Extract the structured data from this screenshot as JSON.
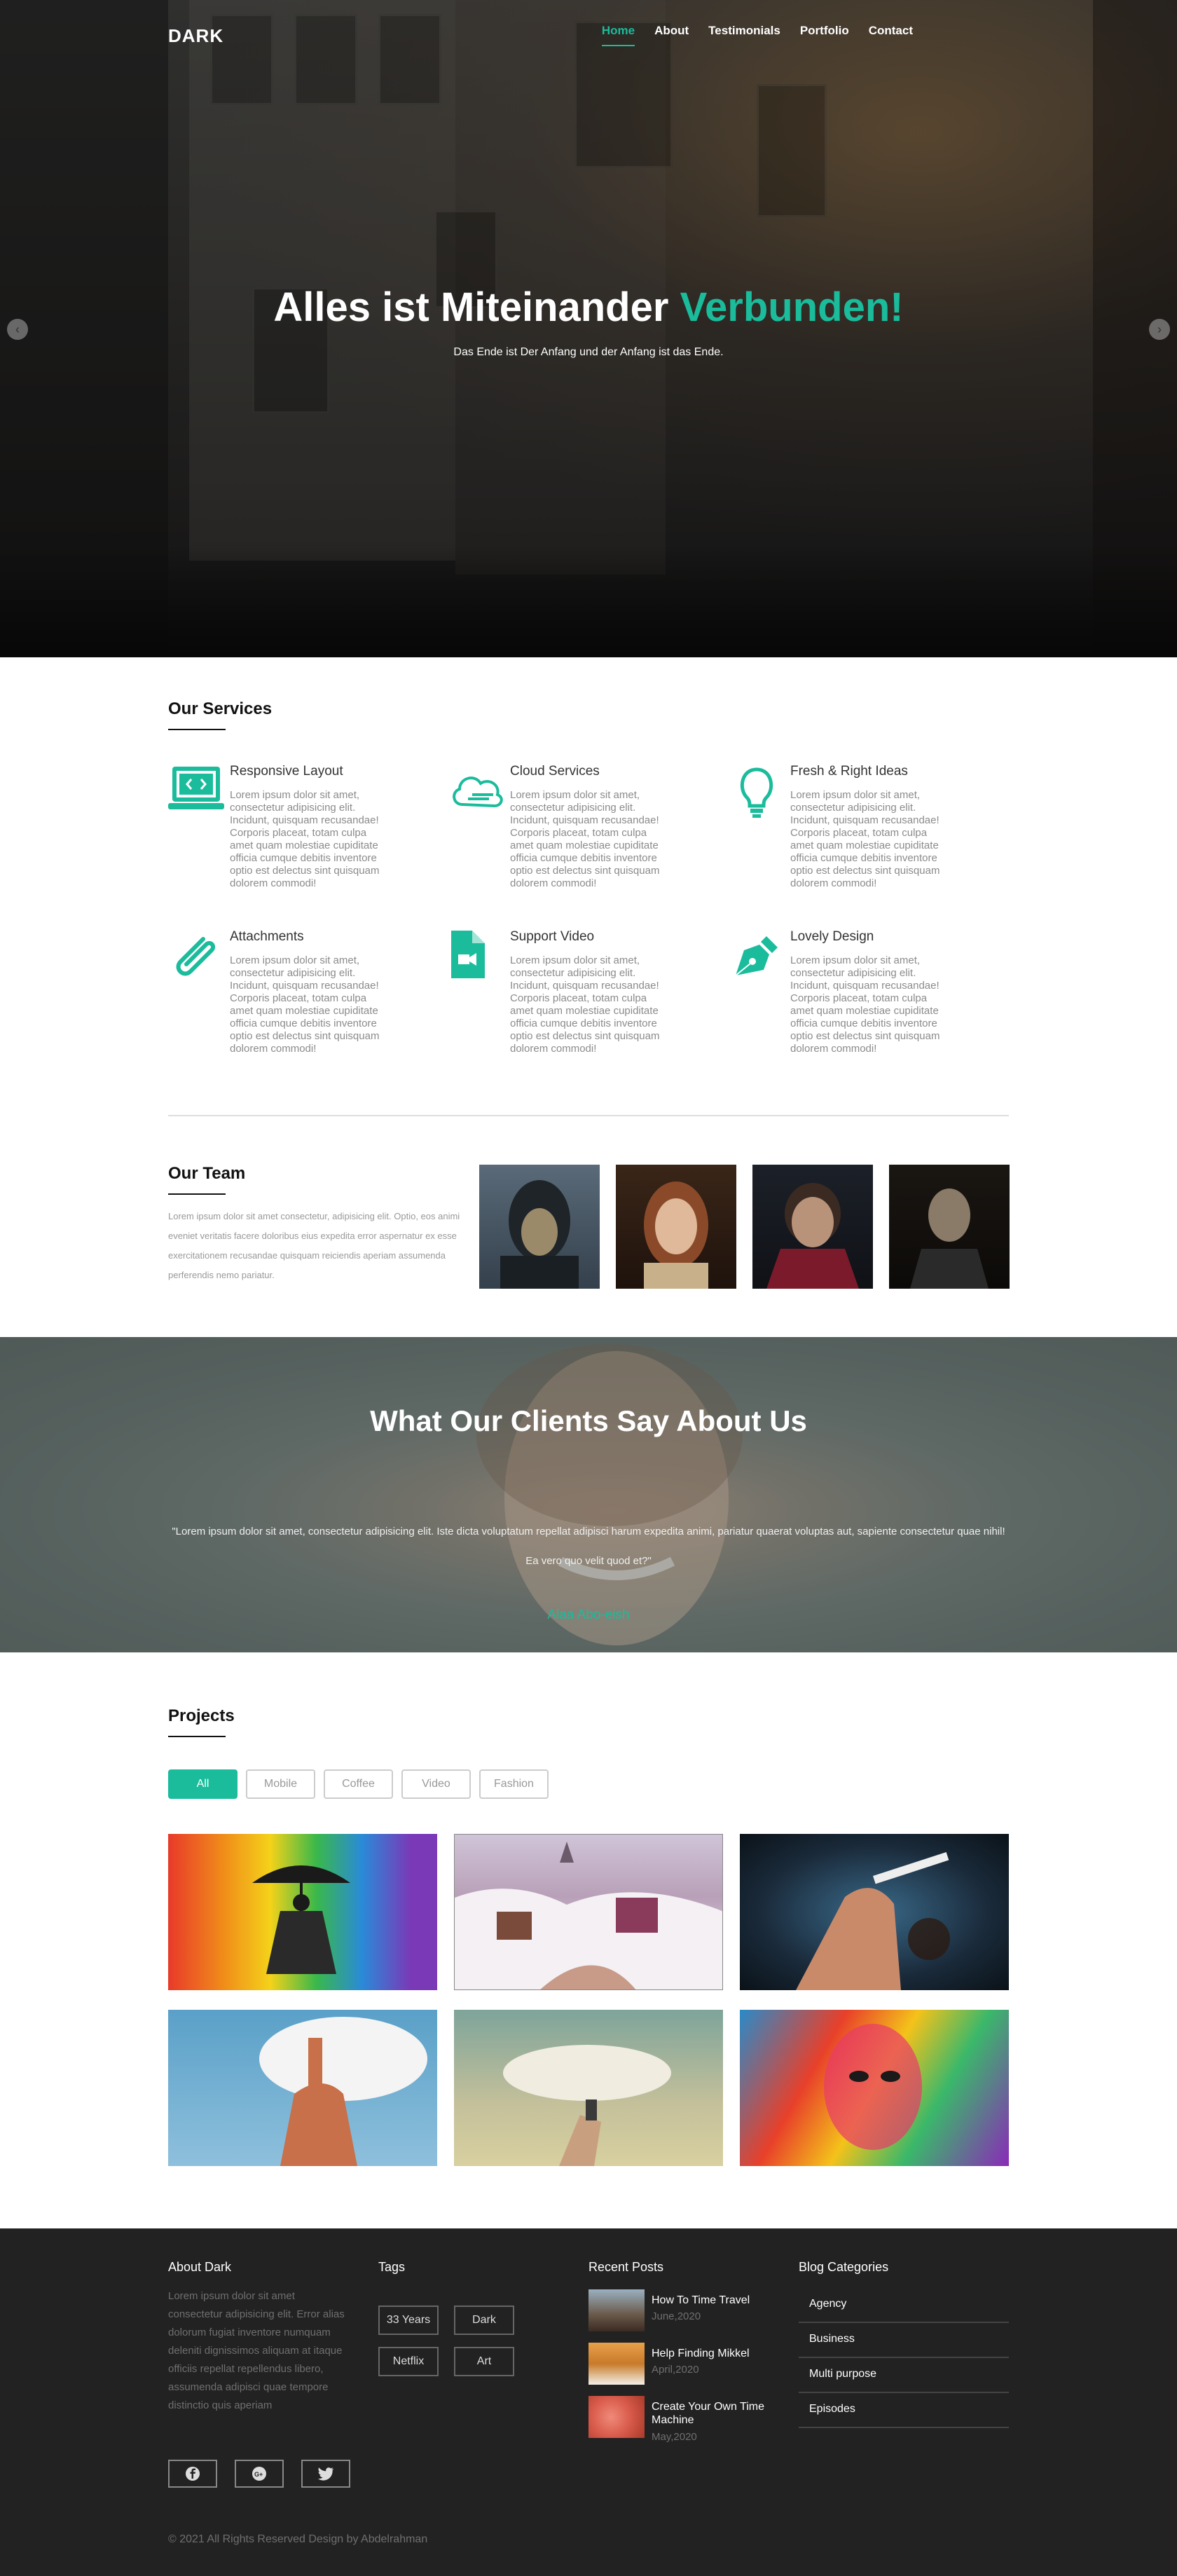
{
  "brand": "DARK",
  "nav": [
    "Home",
    "About",
    "Testimonials",
    "Portfolio",
    "Contact"
  ],
  "hero": {
    "title_main": "Alles ist Miteinander ",
    "title_accent": "Verbunden!",
    "subtitle": "Das Ende ist Der Anfang und der Anfang ist das Ende.",
    "prev": "‹",
    "next": "›"
  },
  "services": {
    "title": "Our Services",
    "items": [
      {
        "title": "Responsive Layout",
        "icon": "laptop-code-icon",
        "text": "Lorem ipsum dolor sit amet, consectetur adipisicing elit. Incidunt, quisquam recusandae! Corporis placeat, totam culpa amet quam molestiae cupiditate officia cumque debitis inventore optio est delectus sint quisquam dolorem commodi!"
      },
      {
        "title": "Cloud Services",
        "icon": "cloud-icon",
        "text": "Lorem ipsum dolor sit amet, consectetur adipisicing elit. Incidunt, quisquam recusandae! Corporis placeat, totam culpa amet quam molestiae cupiditate officia cumque debitis inventore optio est delectus sint quisquam dolorem commodi!"
      },
      {
        "title": "Fresh & Right Ideas",
        "icon": "lightbulb-icon",
        "text": "Lorem ipsum dolor sit amet, consectetur adipisicing elit. Incidunt, quisquam recusandae! Corporis placeat, totam culpa amet quam molestiae cupiditate officia cumque debitis inventore optio est delectus sint quisquam dolorem commodi!"
      },
      {
        "title": "Attachments",
        "icon": "paperclip-icon",
        "text": "Lorem ipsum dolor sit amet, consectetur adipisicing elit. Incidunt, quisquam recusandae! Corporis placeat, totam culpa amet quam molestiae cupiditate officia cumque debitis inventore optio est delectus sint quisquam dolorem commodi!"
      },
      {
        "title": "Support Video",
        "icon": "video-file-icon",
        "text": "Lorem ipsum dolor sit amet, consectetur adipisicing elit. Incidunt, quisquam recusandae! Corporis placeat, totam culpa amet quam molestiae cupiditate officia cumque debitis inventore optio est delectus sint quisquam dolorem commodi!"
      },
      {
        "title": "Lovely Design",
        "icon": "pen-nib-icon",
        "text": "Lorem ipsum dolor sit amet, consectetur adipisicing elit. Incidunt, quisquam recusandae! Corporis placeat, totam culpa amet quam molestiae cupiditate officia cumque debitis inventore optio est delectus sint quisquam dolorem commodi!"
      }
    ]
  },
  "team": {
    "title": "Our Team",
    "text": "Lorem ipsum dolor sit amet consectetur, adipisicing elit. Optio, eos animi eveniet veritatis facere doloribus eius expedita error aspernatur ex esse exercitationem recusandae quisquam reiciendis aperiam assumenda perferendis nemo pariatur."
  },
  "testimonials": {
    "title": "What Our Clients Say About Us",
    "quote": "\"Lorem ipsum dolor sit amet, consectetur adipisicing elit. Iste dicta voluptatum repellat adipisci harum expedita animi, pariatur quaerat voluptas aut, sapiente consectetur quae nihil! Ea vero quo velit quod et?\"",
    "author": "Alaa Abo-eish"
  },
  "projects": {
    "title": "Projects",
    "filters": [
      "All",
      "Mobile",
      "Coffee",
      "Video",
      "Fashion"
    ]
  },
  "footer": {
    "about_title": "About Dark",
    "about_text": "Lorem ipsum dolor sit amet consectetur adipisicing elit. Error alias dolorum fugiat inventore numquam deleniti dignissimos aliquam at itaque officiis repellat repellendus libero, assumenda adipisci quae tempore distinctio quis aperiam",
    "tags_title": "Tags",
    "tags": [
      "33 Years",
      "Dark",
      "Netflix",
      "Art"
    ],
    "posts_title": "Recent Posts",
    "posts": [
      {
        "title": "How To Time Travel",
        "date": "June,2020"
      },
      {
        "title": "Help Finding Mikkel",
        "date": "April,2020"
      },
      {
        "title": "Create Your Own Time Machine",
        "date": "May,2020"
      }
    ],
    "cats_title": "Blog Categories",
    "categories": [
      "Agency",
      "Business",
      "Multi purpose",
      "Episodes"
    ],
    "copyright": "© 2021 All Rights Reserved Design by Abdelrahman"
  },
  "colors": {
    "accent": "#1abc9c",
    "footer_bg": "#222222",
    "text_muted": "#8b8b8b"
  }
}
